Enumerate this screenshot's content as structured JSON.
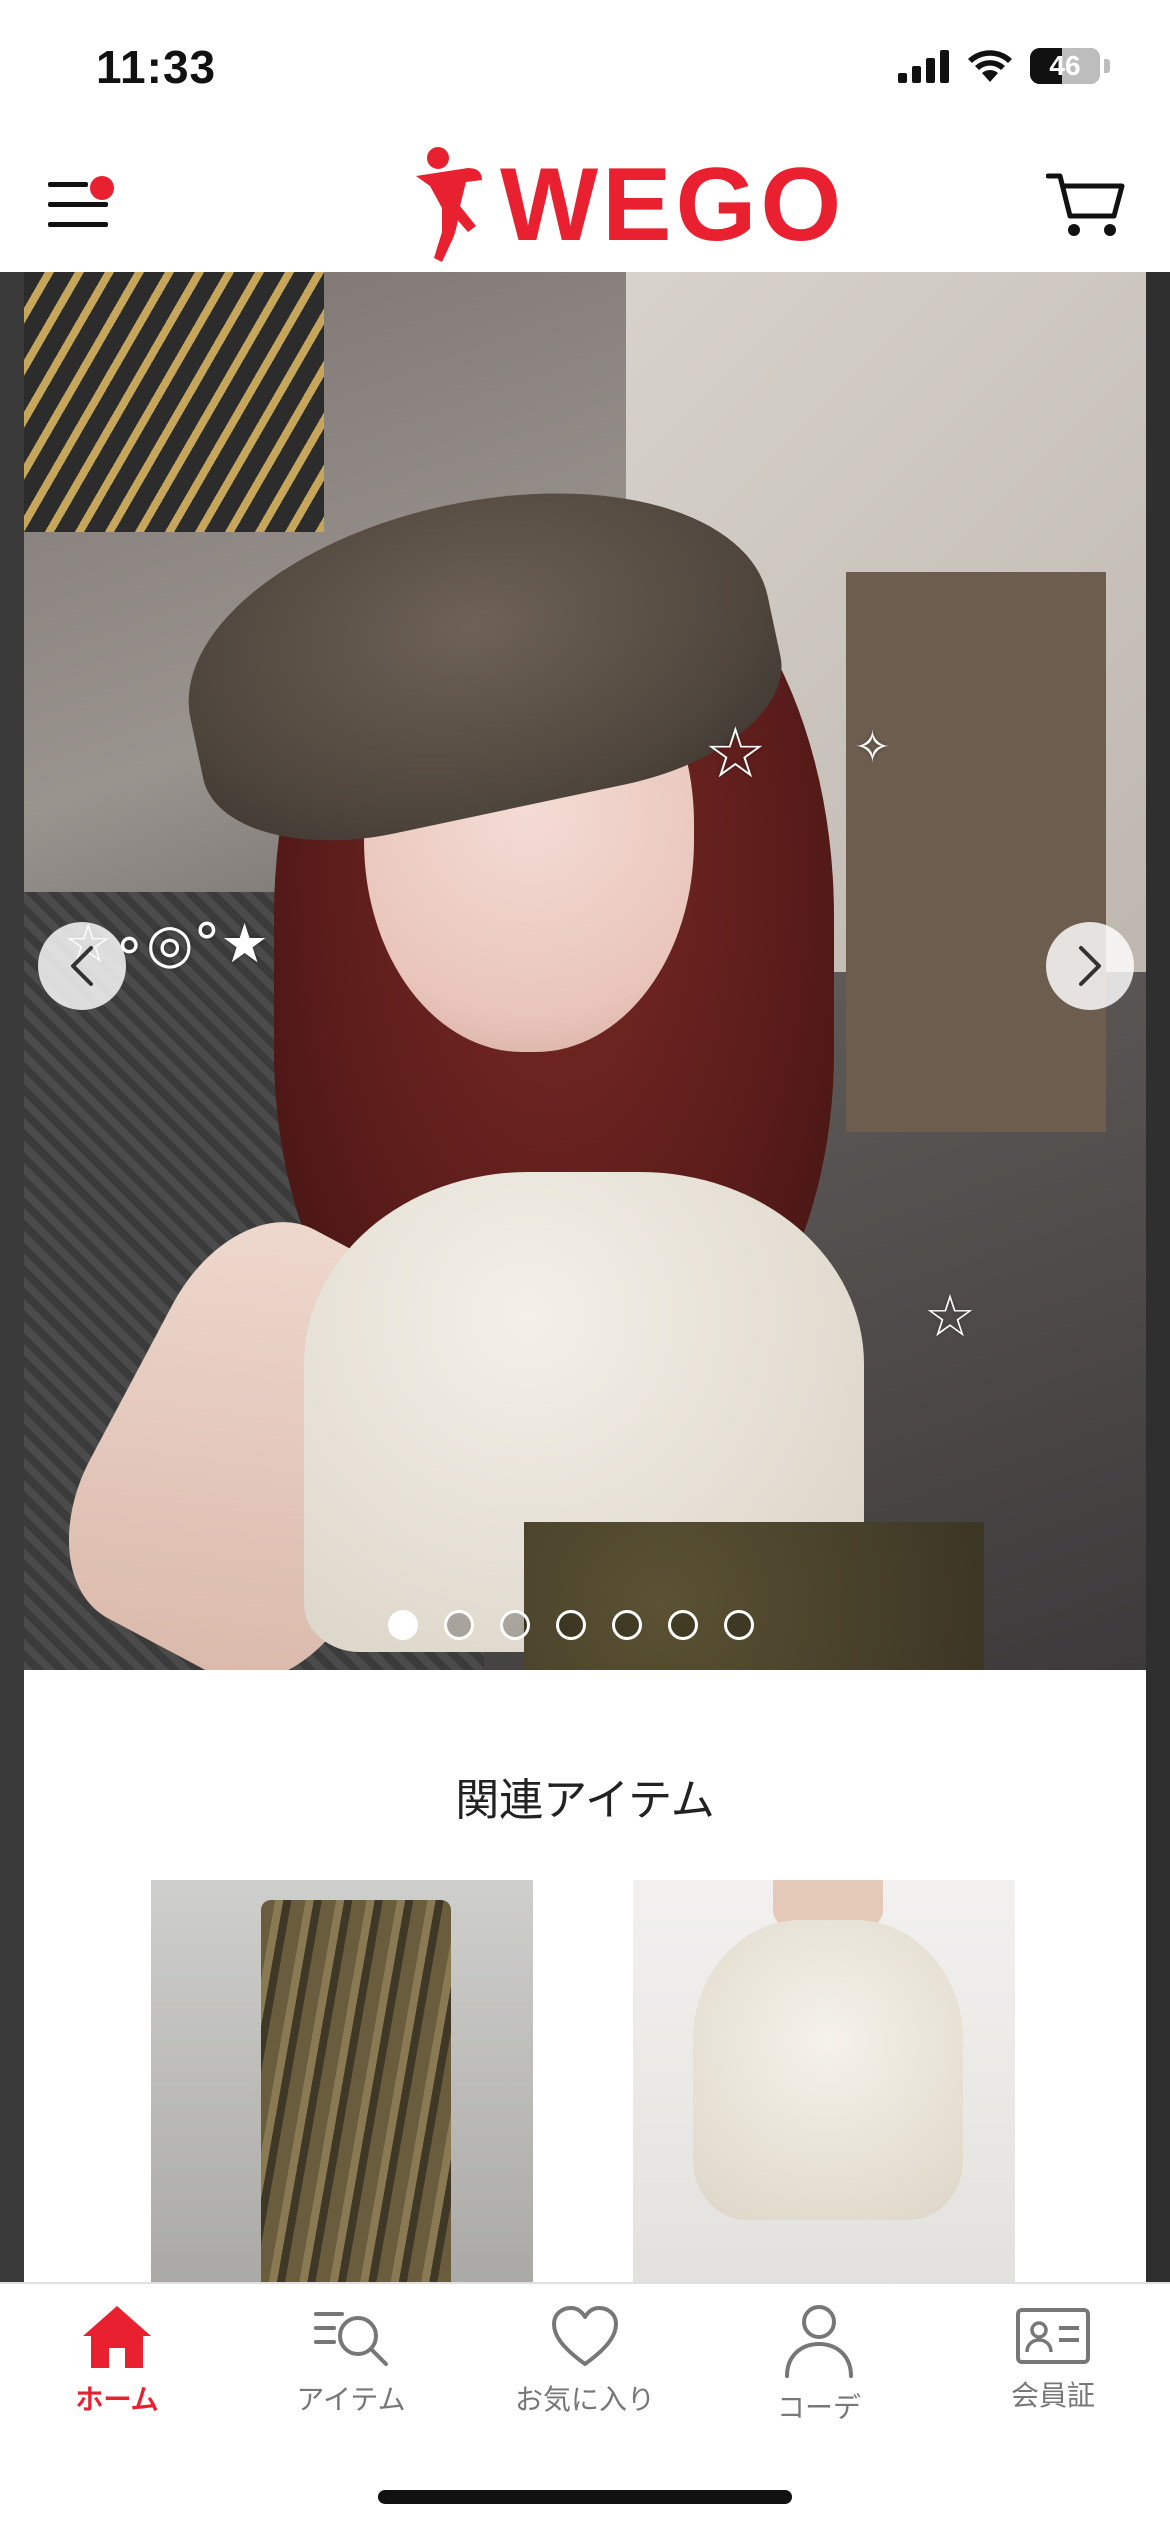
{
  "status_bar": {
    "time": "11:33",
    "battery_level": "46",
    "icons": [
      "cellular-signal-icon",
      "wifi-icon",
      "battery-icon"
    ]
  },
  "header": {
    "logo_text": "WEGO",
    "menu_badge": true,
    "icons": [
      "menu-icon",
      "wego-logo",
      "cart-icon"
    ]
  },
  "carousel": {
    "slide_count": 7,
    "active_index": 0
  },
  "related": {
    "title": "関連アイテム",
    "items": [
      {
        "name": "camouflage-distressed-pants"
      },
      {
        "name": "drawstring-tee"
      }
    ]
  },
  "tab_bar": {
    "active": "home",
    "items": [
      {
        "key": "home",
        "label": "ホーム",
        "icon": "home-icon"
      },
      {
        "key": "items",
        "label": "アイテム",
        "icon": "item-search-icon"
      },
      {
        "key": "favorites",
        "label": "お気に入り",
        "icon": "heart-icon"
      },
      {
        "key": "coordinate",
        "label": "コーデ",
        "icon": "person-icon"
      },
      {
        "key": "member",
        "label": "会員証",
        "icon": "member-card-icon"
      }
    ]
  },
  "colors": {
    "brand_red": "#e8202f",
    "tab_inactive": "#777777"
  }
}
